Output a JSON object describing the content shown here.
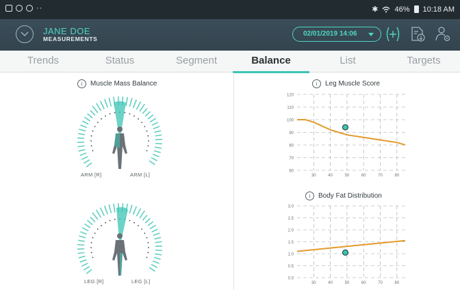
{
  "statusbar": {
    "left_icons": [
      "gallery-icon",
      "sync-icon",
      "link-icon"
    ],
    "dots": "··",
    "bluetooth": "✱",
    "battery": "46%",
    "time": "10:18 AM"
  },
  "header": {
    "user_name": "JANE DOE",
    "section": "MEASUREMENTS",
    "date": "02/01/2019 14:06"
  },
  "tabs": [
    "Trends",
    "Status",
    "Segment",
    "Balance",
    "List",
    "Targets"
  ],
  "active_tab": "Balance",
  "colors": {
    "accent": "#3bc4b3",
    "curve": "#e39a2b",
    "header_bg": "#354650"
  },
  "muscle_balance": {
    "title": "Muscle Mass Balance",
    "arm_labels": {
      "left": "ARM [R]",
      "right": "ARM [L]"
    },
    "leg_labels": {
      "left": "LEG [R]",
      "right": "LEG [L]"
    }
  },
  "chart_data": [
    {
      "type": "scatter",
      "title": "Leg Muscle Score",
      "xlabel": "",
      "ylabel": "",
      "x_ticks": [
        "30",
        "40",
        "50",
        "60",
        "70",
        "80"
      ],
      "y_ticks": [
        "60",
        "70",
        "80",
        "90",
        "100",
        "110",
        "120"
      ],
      "xlim": [
        20,
        85
      ],
      "ylim": [
        60,
        120
      ],
      "grid": true,
      "reference_curve": {
        "x": [
          20,
          25,
          30,
          40,
          50,
          60,
          70,
          80,
          85
        ],
        "y": [
          100,
          100,
          98,
          92,
          88,
          86,
          84,
          82,
          80
        ]
      },
      "points": [
        {
          "x": 49,
          "y": 94
        }
      ]
    },
    {
      "type": "scatter",
      "title": "Body Fat Distribution",
      "xlabel": "",
      "ylabel": "",
      "x_ticks": [
        "30",
        "40",
        "50",
        "60",
        "70",
        "80"
      ],
      "y_ticks": [
        "0.0",
        "0.5",
        "1.0",
        "1.5",
        "2.0",
        "2.5",
        "3.0"
      ],
      "xlim": [
        20,
        85
      ],
      "ylim": [
        0,
        3
      ],
      "grid": true,
      "reference_curve": {
        "x": [
          20,
          85
        ],
        "y": [
          1.1,
          1.55
        ]
      },
      "points": [
        {
          "x": 49,
          "y": 1.05
        }
      ]
    }
  ]
}
